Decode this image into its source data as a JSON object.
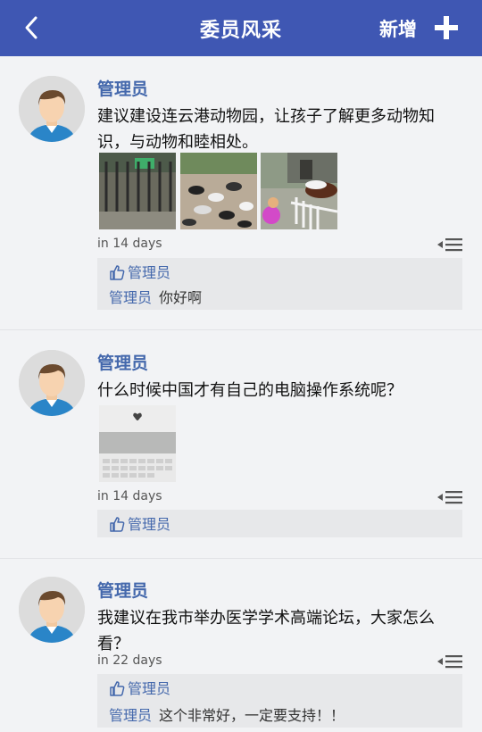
{
  "header": {
    "title": "委员风采",
    "add_label": "新增",
    "back_icon": "chevron-left-icon",
    "add_icon": "plus-icon",
    "bg_color": "#3f57b3"
  },
  "posts": [
    {
      "author": "管理员",
      "content": "建议建设连云港动物园，让孩子了解更多动物知识，与动物和睦相处。",
      "time": "in 14 days",
      "likes": "管理员",
      "comments": [
        {
          "author": "管理员",
          "text": "你好啊"
        }
      ]
    },
    {
      "author": "管理员",
      "content": "什么时候中国才有自己的电脑操作系统呢？",
      "time": "in 14 days",
      "likes": "管理员",
      "comments": []
    },
    {
      "author": "管理员",
      "content": "我建议在我市举办医学学术高端论坛，大家怎么看？",
      "time": "in 22 days",
      "likes": "管理员",
      "comments": [
        {
          "author": "管理员",
          "text": "这个非常好，一定要支持！！"
        }
      ]
    }
  ],
  "colors": {
    "accent": "#4468ac",
    "background": "#f2f3f5",
    "comment_bg": "#e7e8ea"
  }
}
